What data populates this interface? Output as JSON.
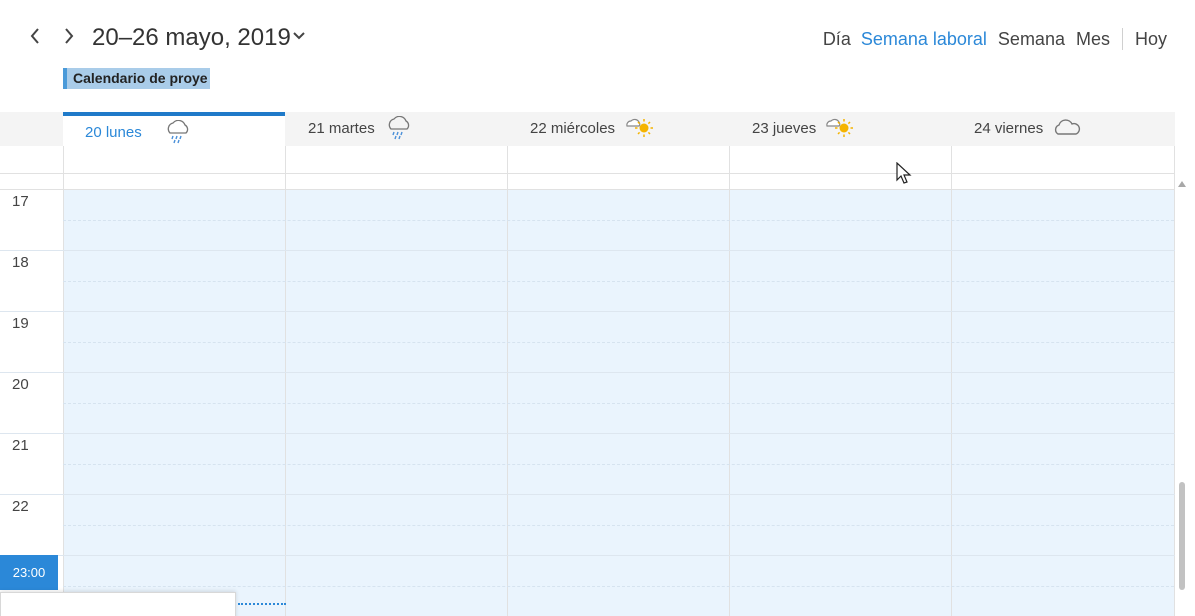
{
  "header": {
    "prev_label": "Previous",
    "next_label": "Next",
    "date_range": "20–26 mayo, 2019"
  },
  "views": {
    "day": "Día",
    "work_week": "Semana laboral",
    "week": "Semana",
    "month": "Mes",
    "today": "Hoy",
    "active": "work_week"
  },
  "calendar_chip": "Calendario de proye",
  "days": [
    {
      "label": "20 lunes",
      "weather": "rain-icon",
      "today": true
    },
    {
      "label": "21 martes",
      "weather": "rain-icon",
      "today": false
    },
    {
      "label": "22 miércoles",
      "weather": "partly-sunny-icon",
      "today": false
    },
    {
      "label": "23 jueves",
      "weather": "partly-sunny-icon",
      "today": false
    },
    {
      "label": "24 viernes",
      "weather": "cloud-icon",
      "today": false
    }
  ],
  "hours": [
    "17",
    "18",
    "19",
    "20",
    "21",
    "22"
  ],
  "current_time": "23:00",
  "colors": {
    "accent": "#2b88d8",
    "today_bar": "#1f7ac9",
    "grid_background": "#eaf4fd",
    "chip_background": "#a9cce9"
  }
}
